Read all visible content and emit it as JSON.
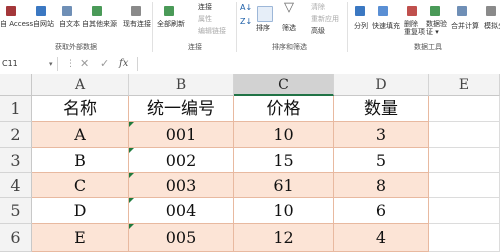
{
  "ribbon": {
    "external_data": {
      "buttons": [
        "自 Access",
        "自网站",
        "自文本",
        "自其他来源",
        "现有连接"
      ],
      "group_label": "获取外部数据"
    },
    "connections": {
      "refresh_label": "全部刷新",
      "items": [
        "连接",
        "属性",
        "编辑链接"
      ],
      "group_label": "连接"
    },
    "sort_filter": {
      "sort_label": "排序",
      "filter_label": "筛选",
      "items": [
        "清除",
        "重新应用",
        "高级"
      ],
      "group_label": "排序和筛选"
    },
    "data_tools": {
      "buttons": [
        "分列",
        "快速填充",
        "删除\n重复项",
        "数据验\n证 ▾",
        "合并计算",
        "模拟分析"
      ],
      "group_label": "数据工具"
    }
  },
  "formula_bar": {
    "name_box": "C11",
    "cancel": "✕",
    "enter": "✓",
    "fx": "fx",
    "formula": ""
  },
  "sheet": {
    "columns": [
      "A",
      "B",
      "C",
      "D",
      "E"
    ],
    "selected_column": "C",
    "rows": [
      "1",
      "2",
      "3",
      "4",
      "5",
      "6"
    ],
    "table": {
      "headers": [
        "名称",
        "统一编号",
        "价格",
        "数量"
      ],
      "rows": [
        [
          "A",
          "001",
          "10",
          "3"
        ],
        [
          "B",
          "002",
          "15",
          "5"
        ],
        [
          "C",
          "003",
          "61",
          "8"
        ],
        [
          "D",
          "004",
          "10",
          "6"
        ],
        [
          "E",
          "005",
          "12",
          "4"
        ]
      ]
    }
  },
  "colors": {
    "header_row_fill": "#ffffff",
    "band_fill": "#fce4d6",
    "selected_column_header": "#d2d2d2",
    "accent": "#217346"
  }
}
